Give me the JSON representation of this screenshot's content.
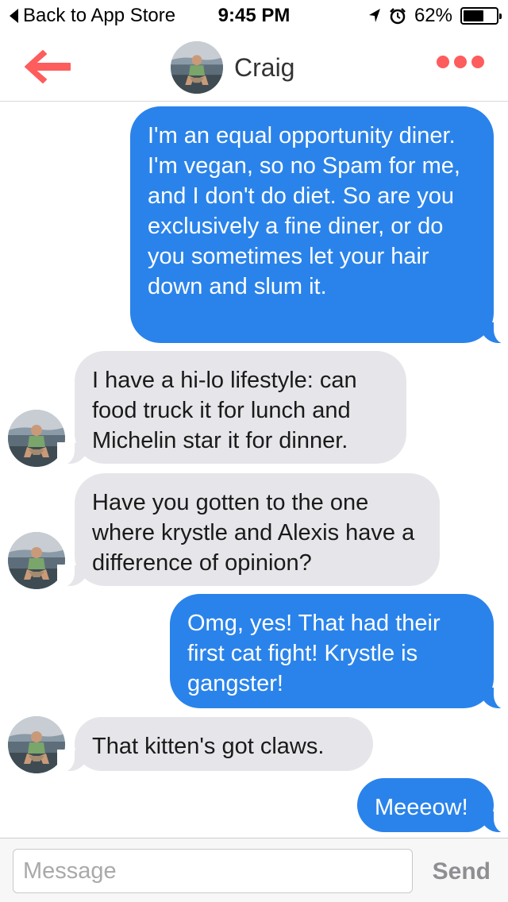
{
  "status_bar": {
    "back_label": "Back to App Store",
    "time": "9:45 PM",
    "battery": "62%",
    "battery_level": 0.62
  },
  "header": {
    "contact_name": "Craig",
    "back_icon": "back-arrow-icon",
    "more_icon": "more-dots-icon",
    "accent_color": "#fd5d5d"
  },
  "messages": [
    {
      "direction": "out",
      "text": "I'm an equal opportunity diner. I'm vegan, so no Spam for me, and I don't do diet. So are you exclusively a fine diner, or do you sometimes let your hair down and slum it."
    },
    {
      "direction": "in",
      "text": "I have a hi-lo lifestyle: can food truck it for lunch and Michelin star it for dinner."
    },
    {
      "direction": "in",
      "text": "Have you gotten to the one where krystle and Alexis have a difference of opinion?"
    },
    {
      "direction": "out",
      "text": "Omg, yes!  That had their first cat fight! Krystle is gangster!"
    },
    {
      "direction": "in",
      "text": "That kitten's got claws."
    },
    {
      "direction": "out",
      "text": "Meeeow!"
    }
  ],
  "compose": {
    "placeholder": "Message",
    "value": "",
    "send_label": "Send"
  },
  "colors": {
    "outgoing_bubble": "#2a83ea",
    "incoming_bubble": "#e6e6ea"
  }
}
